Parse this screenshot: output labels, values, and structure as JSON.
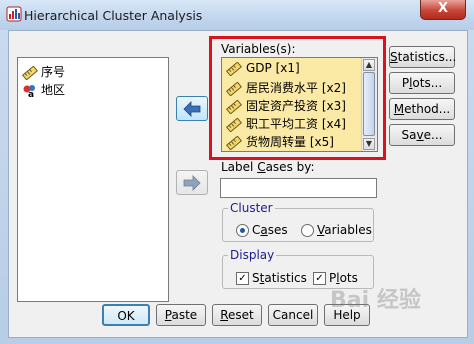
{
  "window": {
    "title": "Hierarchical Cluster Analysis",
    "close_label": "X"
  },
  "source_list": {
    "items": [
      {
        "label": "序号",
        "icon": "scale-ruler-icon"
      },
      {
        "label": "地区",
        "icon": "nominal-variable-icon"
      }
    ]
  },
  "variables": {
    "label": "Variables(s):",
    "items": [
      {
        "label": "GDP [x1]",
        "icon": "scale-ruler-icon"
      },
      {
        "label": "居民消费水平 [x2]",
        "icon": "scale-ruler-icon"
      },
      {
        "label": "固定资产投资 [x3]",
        "icon": "scale-ruler-icon"
      },
      {
        "label": "职工平均工资 [x4]",
        "icon": "scale-ruler-icon"
      },
      {
        "label": "货物周转量 [x5]",
        "icon": "scale-ruler-icon"
      }
    ],
    "highlight_color": "#d8131e",
    "item_bg": "#fbe9a6"
  },
  "label_cases": {
    "label_pre": "Label ",
    "label_key": "C",
    "label_post": "ases by:",
    "value": ""
  },
  "cluster_group": {
    "title": "Cluster",
    "options": [
      {
        "pre": "C",
        "key": "a",
        "post": "ses",
        "selected": true
      },
      {
        "pre": "",
        "key": "V",
        "post": "ariables",
        "selected": false
      }
    ]
  },
  "display_group": {
    "title": "Display",
    "options": [
      {
        "pre": "S",
        "key": "t",
        "post": "atistics",
        "checked": true
      },
      {
        "pre": "P",
        "key": "l",
        "post": "ots",
        "checked": true
      }
    ]
  },
  "side_buttons": [
    {
      "pre": "",
      "key": "S",
      "post": "tatistics..."
    },
    {
      "pre": "P",
      "key": "l",
      "post": "ots..."
    },
    {
      "pre": "",
      "key": "M",
      "post": "ethod..."
    },
    {
      "pre": "Sa",
      "key": "v",
      "post": "e..."
    }
  ],
  "bottom_buttons": [
    {
      "pre": "OK",
      "key": "",
      "post": ""
    },
    {
      "pre": "",
      "key": "P",
      "post": "aste"
    },
    {
      "pre": "",
      "key": "R",
      "post": "eset"
    },
    {
      "pre": "Cancel",
      "key": "",
      "post": ""
    },
    {
      "pre": "Help",
      "key": "",
      "post": ""
    }
  ],
  "watermark": "Bai 经验"
}
